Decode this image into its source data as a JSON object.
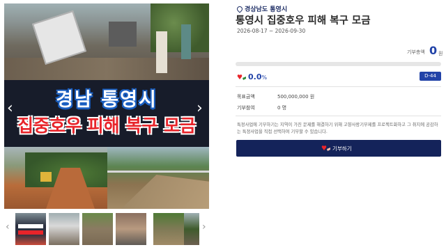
{
  "gallery": {
    "banner_line1": "경남  통영시",
    "banner_line2": "집중호우 피해 복구 모금",
    "prev_arrow": "‹",
    "next_arrow": "›",
    "thumb_prev": "‹",
    "thumb_next": "›",
    "thumbnail_count": 6,
    "active_thumbnail": 1
  },
  "campaign": {
    "region": "경상남도 통영시",
    "region_icon": "map-pin-icon",
    "title": "통영시 집중호우 피해 복구 모금",
    "period": "2026-08-17 ~ 2026-09-30",
    "amount_label": "기부총액",
    "amount_value": "0",
    "amount_unit": "원",
    "progress_percent": 0.0,
    "percent_value": "0.0",
    "percent_unit": "%",
    "dday": "D-44",
    "goal_label": "목표금액",
    "goal_value": "500,000,000 원",
    "participants_label": "기부참여",
    "participants_value": "0 명",
    "description": "특정사업에 기부하기는 지역이 가진 문제를 해결하기 위해 고향사랑기부제를 프로젝트화하고 그 취지에 공감하는 특정사업을 직접 선택하여 기부할 수 있습니다.",
    "donate_label": "기부하기",
    "donate_icon": "heart-hand-icon"
  },
  "colors": {
    "accent": "#2243a8",
    "button": "#14235a",
    "heart": "#e8242a"
  }
}
